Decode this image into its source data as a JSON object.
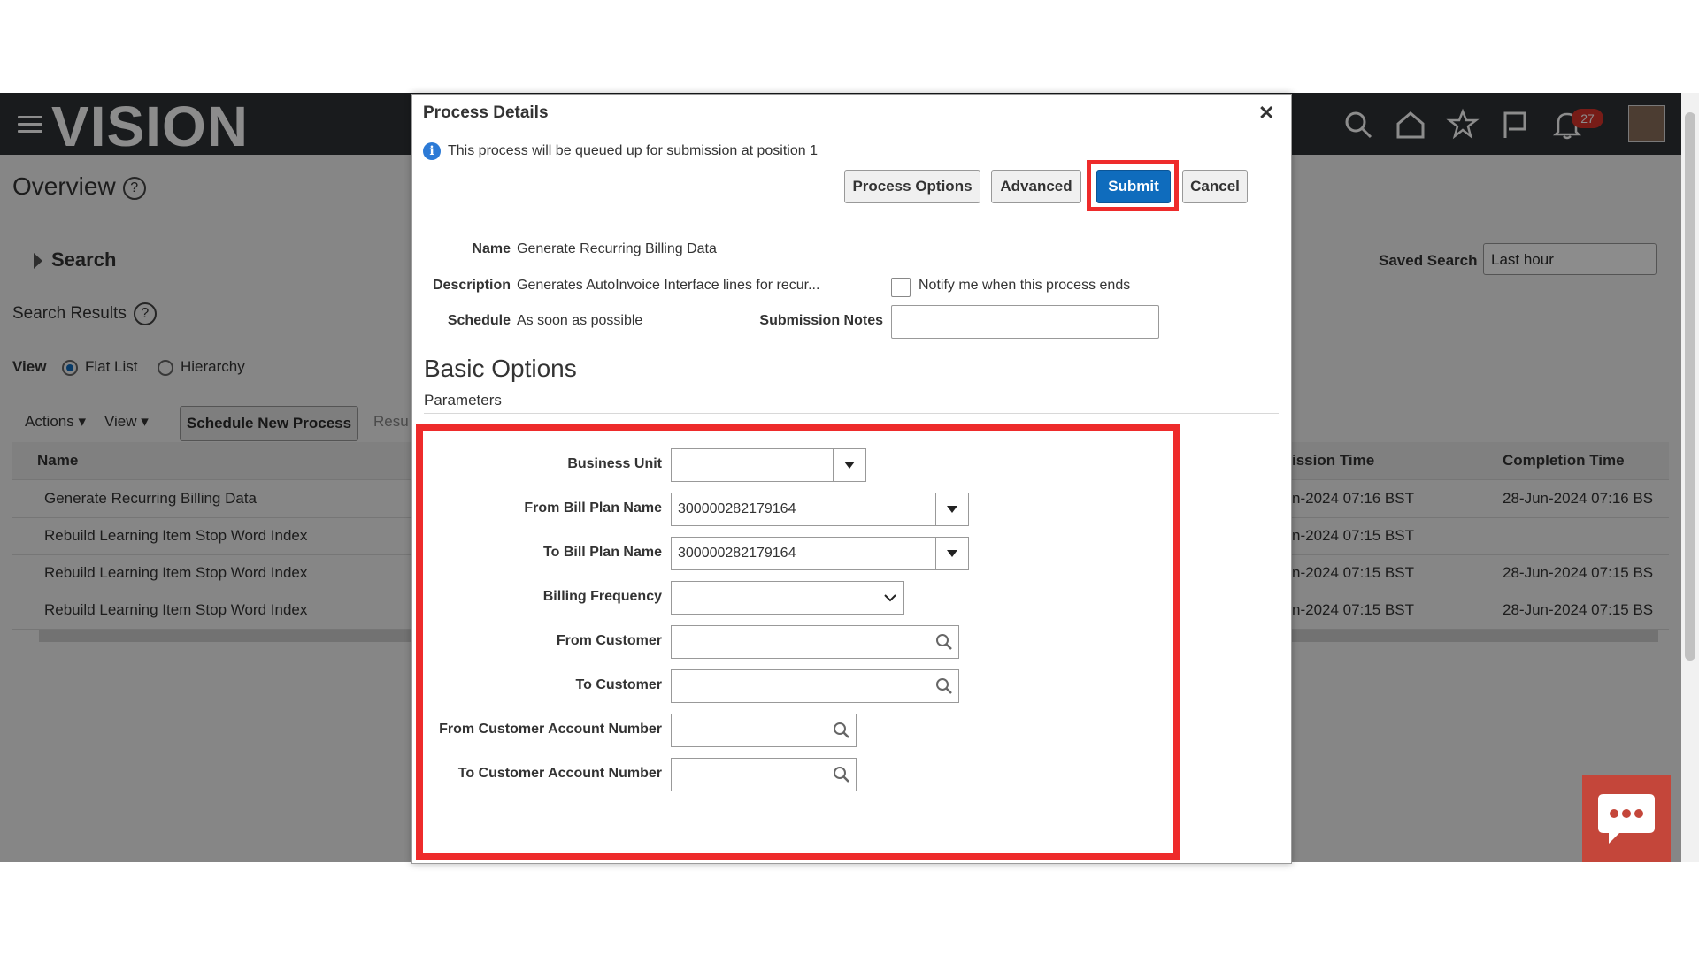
{
  "app": {
    "logo": "VISION",
    "notifications_count": "27",
    "icons": [
      "menu-icon",
      "search-icon",
      "home-icon",
      "star-icon",
      "flag-icon",
      "bell-icon",
      "avatar"
    ]
  },
  "background": {
    "page_title": "Overview",
    "search_label": "Search",
    "search_results_label": "Search Results",
    "view_label": "View",
    "view_options": [
      "Flat List",
      "Hierarchy"
    ],
    "actions_label": "Actions",
    "view_menu_label": "View",
    "schedule_button": "Schedule New Process",
    "resubmit_partial": "Resu",
    "saved_search_label": "Saved Search",
    "saved_search_value": "Last hour",
    "table": {
      "col_name": "Name",
      "col_submission_partial": "ission Time",
      "col_completion": "Completion Time",
      "rows": [
        {
          "name": "Generate Recurring Billing Data",
          "submission": "n-2024 07:16 BST",
          "completion": "28-Jun-2024 07:16 BS"
        },
        {
          "name": "Rebuild Learning Item Stop Word Index",
          "submission": "n-2024 07:15 BST",
          "completion": ""
        },
        {
          "name": "Rebuild Learning Item Stop Word Index",
          "submission": "n-2024 07:15 BST",
          "completion": "28-Jun-2024 07:15 BS"
        },
        {
          "name": "Rebuild Learning Item Stop Word Index",
          "submission": "n-2024 07:15 BST",
          "completion": "28-Jun-2024 07:15 BS"
        }
      ]
    }
  },
  "dialog": {
    "title": "Process Details",
    "info_message": "This process will be queued up for submission at position 1",
    "buttons": {
      "process_options": "Process Options",
      "advanced": "Advanced",
      "submit": "Submit",
      "cancel": "Cancel"
    },
    "details": {
      "name_label": "Name",
      "name_value": "Generate Recurring Billing Data",
      "description_label": "Description",
      "description_value": "Generates AutoInvoice Interface lines for recur...",
      "schedule_label": "Schedule",
      "schedule_value": "As soon as possible",
      "notify_label": "Notify me when this process ends",
      "submission_notes_label": "Submission Notes",
      "submission_notes_value": ""
    },
    "section_title": "Basic Options",
    "subsection_title": "Parameters",
    "parameters": {
      "business_unit_label": "Business Unit",
      "business_unit_value": "",
      "from_bill_plan_label": "From Bill Plan Name",
      "from_bill_plan_value": "300000282179164",
      "to_bill_plan_label": "To Bill Plan Name",
      "to_bill_plan_value": "300000282179164",
      "billing_frequency_label": "Billing Frequency",
      "billing_frequency_value": "",
      "from_customer_label": "From Customer",
      "from_customer_value": "",
      "to_customer_label": "To Customer",
      "to_customer_value": "",
      "from_account_label": "From Customer Account Number",
      "from_account_value": "",
      "to_account_label": "To Customer Account Number",
      "to_account_value": ""
    }
  },
  "colors": {
    "highlight": "#ee2b2b",
    "primary_button": "#0f6cbd",
    "topbar": "#2f3236"
  }
}
